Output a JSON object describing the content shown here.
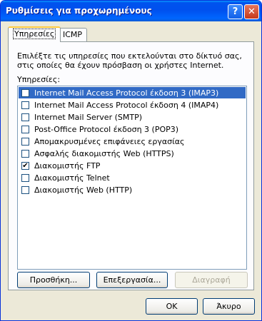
{
  "window": {
    "title": "Ρυθμίσεις για προχωρημένους",
    "help_label": "?",
    "close_label": "✕"
  },
  "tabs": [
    {
      "label": "Υπηρεσίες"
    },
    {
      "label": "ICMP"
    }
  ],
  "services": {
    "description": "Επιλέξτε τις υπηρεσίες που εκτελούνται στο δίκτυό σας, στις οποίες θα έχουν πρόσβαση οι χρήστες Internet.",
    "list_label": "Υπηρεσίες:",
    "items": [
      {
        "label": "Internet Mail Access Protocol έκδοση 3 (IMAP3)",
        "checked": false
      },
      {
        "label": "Internet Mail Access Protocol έκδοση 4 (IMAP4)",
        "checked": false
      },
      {
        "label": "Internet Mail Server (SMTP)",
        "checked": false
      },
      {
        "label": "Post-Office Protocol έκδοση 3 (POP3)",
        "checked": false
      },
      {
        "label": "Απομακρυσμένες επιφάνειες εργασίας",
        "checked": false
      },
      {
        "label": "Ασφαλής διακομιστής Web (HTTPS)",
        "checked": false
      },
      {
        "label": "Διακομιστής FTP",
        "checked": true
      },
      {
        "label": "Διακομιστής Telnet",
        "checked": false
      },
      {
        "label": "Διακομιστής Web (HTTP)",
        "checked": false
      }
    ],
    "add_label": "Προσθήκη...",
    "edit_label": "Επεξεργασία...",
    "delete_label": "Διαγραφή"
  },
  "footer": {
    "ok_label": "OK",
    "cancel_label": "Άκυρο"
  },
  "colors": {
    "selection": "#316ac5",
    "titlebar": "#0053ee"
  }
}
